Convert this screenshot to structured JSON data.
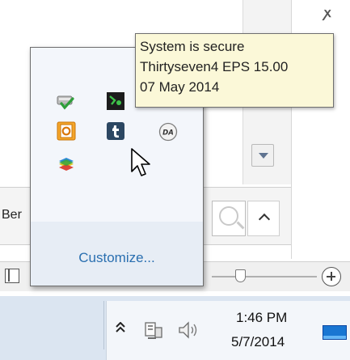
{
  "app": {
    "partial_label": "Ber",
    "corner_glyph": "ꭗ"
  },
  "popup": {
    "customize_label": "Customize...",
    "icons": [
      "security-check-icon",
      "terminal-app-icon",
      "hidden-icon",
      "outlook-icon",
      "tumblr-icon",
      "da-icon",
      "bluestacks-icon"
    ]
  },
  "tooltip": {
    "line1": "System is secure",
    "line2": "Thirtyseven4 EPS 15.00",
    "line3": "07 May 2014"
  },
  "taskbar": {
    "show_hidden_label": "ᐃ",
    "time": "1:46 PM",
    "date": "5/7/2014"
  },
  "colors": {
    "accent": "#2a6fb0",
    "tooltip_bg": "#fbf8d8",
    "taskbar_bg": "#dbe5f1"
  }
}
